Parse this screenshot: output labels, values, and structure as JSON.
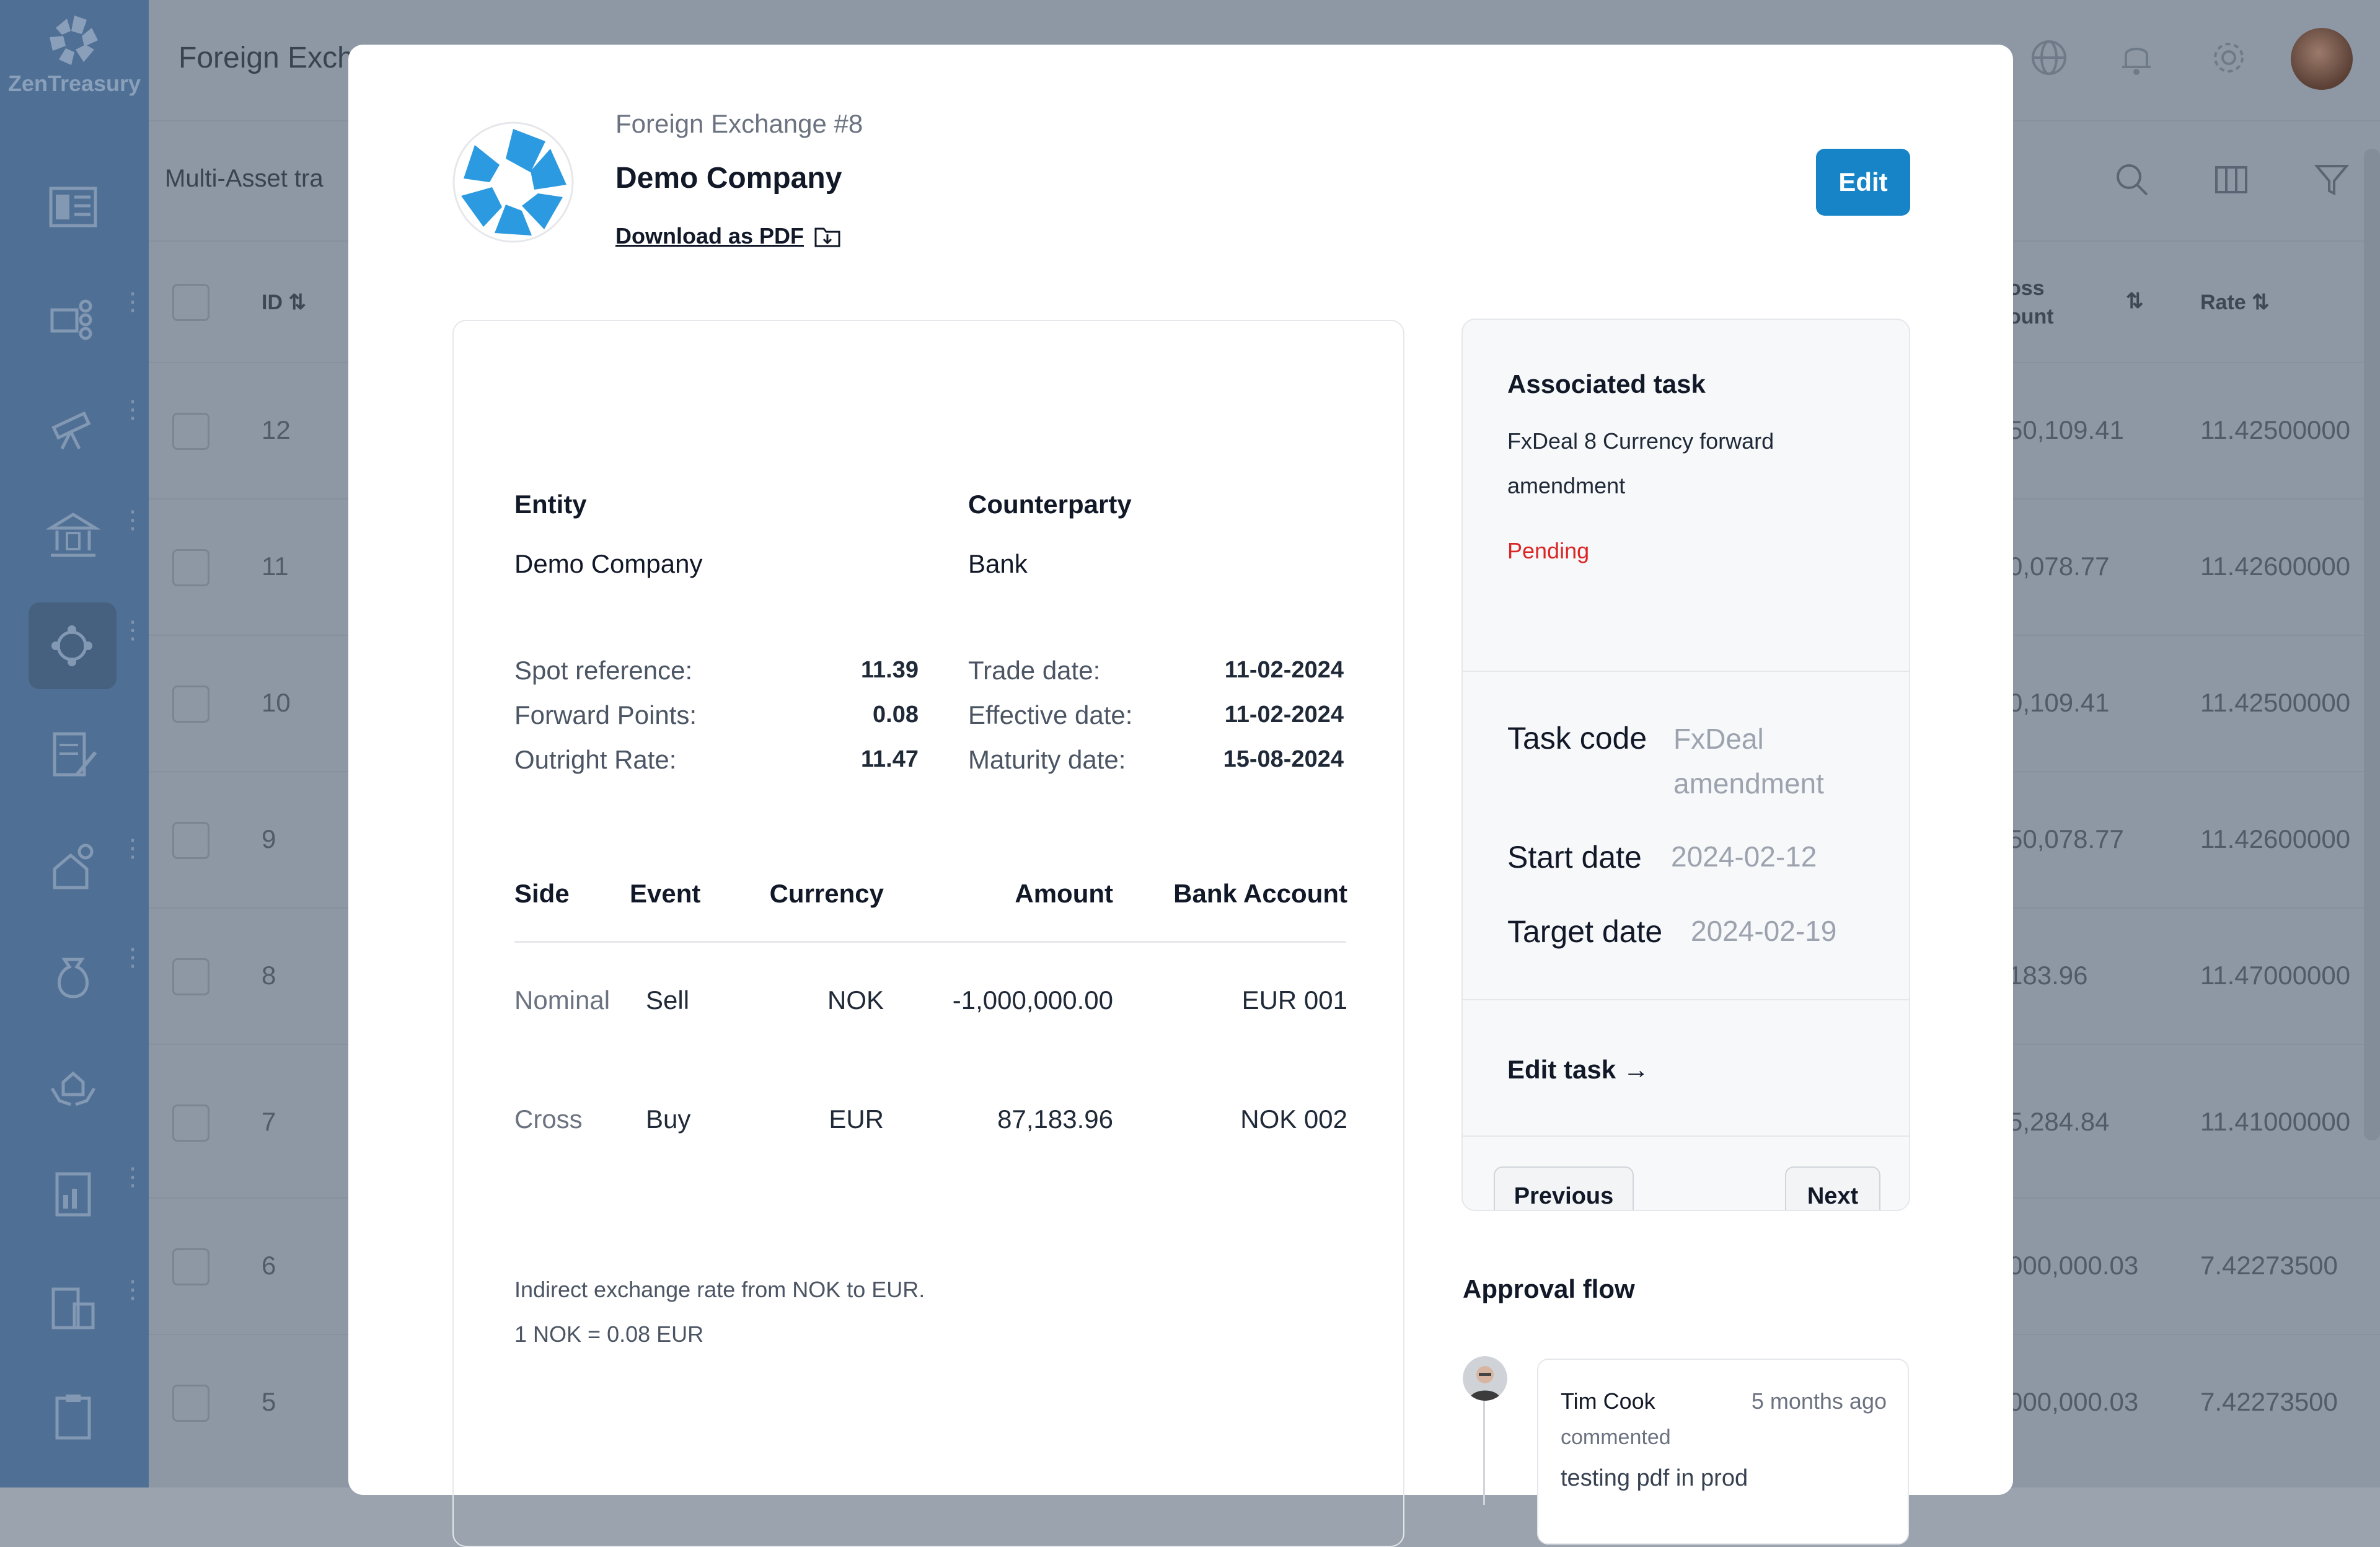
{
  "app": {
    "brand": "ZenTreasury",
    "page_title": "Foreign Exch",
    "sub_title": "Multi-Asset tra"
  },
  "background_table": {
    "headers": {
      "id": "ID",
      "gross": "oss\nount",
      "rate": "Rate"
    },
    "rows": [
      {
        "id": "12",
        "amount": "50,109.41",
        "rate": "11.42500000"
      },
      {
        "id": "11",
        "amount": "0,078.77",
        "rate": "11.42600000"
      },
      {
        "id": "10",
        "amount": "0,109.41",
        "rate": "11.42500000"
      },
      {
        "id": "9",
        "amount": "50,078.77",
        "rate": "11.42600000"
      },
      {
        "id": "8",
        "amount": "183.96",
        "rate": "11.47000000"
      },
      {
        "id": "7",
        "amount": "5,284.84",
        "rate": "11.41000000"
      },
      {
        "id": "6",
        "amount": "000,000.03",
        "rate": "7.42273500"
      },
      {
        "id": "5",
        "amount": "000,000.03",
        "rate": "7.42273500"
      }
    ]
  },
  "modal": {
    "eyebrow": "Foreign Exchange #8",
    "title": "Demo Company",
    "download_label": "Download as PDF",
    "edit_label": "Edit",
    "entity_label": "Entity",
    "entity_value": "Demo Company",
    "counterparty_label": "Counterparty",
    "counterparty_value": "Bank",
    "left_kv": [
      {
        "label": "Spot reference:",
        "value": "11.39"
      },
      {
        "label": "Forward Points:",
        "value": "0.08"
      },
      {
        "label": "Outright Rate:",
        "value": "11.47"
      }
    ],
    "right_kv": [
      {
        "label": "Trade date:",
        "value": "11-02-2024"
      },
      {
        "label": "Effective date:",
        "value": "11-02-2024"
      },
      {
        "label": "Maturity date:",
        "value": "15-08-2024"
      }
    ],
    "table": {
      "headers": [
        "Side",
        "Event",
        "Currency",
        "Amount",
        "Bank Account"
      ],
      "rows": [
        [
          "Nominal",
          "Sell",
          "NOK",
          "-1,000,000.00",
          "EUR 001"
        ],
        [
          "Cross",
          "Buy",
          "EUR",
          "87,183.96",
          "NOK 002"
        ]
      ]
    },
    "note_line1": "Indirect exchange rate from NOK to EUR.",
    "note_line2": "1 NOK = 0.08 EUR"
  },
  "task": {
    "title": "Associated task",
    "description": "FxDeal 8 Currency forward amendment",
    "status": "Pending",
    "code_label": "Task code",
    "code_value": "FxDeal amendment",
    "start_label": "Start date",
    "start_value": "2024-02-12",
    "target_label": "Target date",
    "target_value": "2024-02-19",
    "edit_task_label": "Edit task →",
    "previous_label": "Previous",
    "next_label": "Next"
  },
  "approval": {
    "title": "Approval flow",
    "comment": {
      "author": "Tim Cook",
      "time": "5 months ago",
      "action": "commented",
      "text": "testing pdf in prod"
    }
  },
  "colors": {
    "accent": "#1684c7",
    "pending": "#dc2626",
    "sidebar": "#4f6f95"
  }
}
